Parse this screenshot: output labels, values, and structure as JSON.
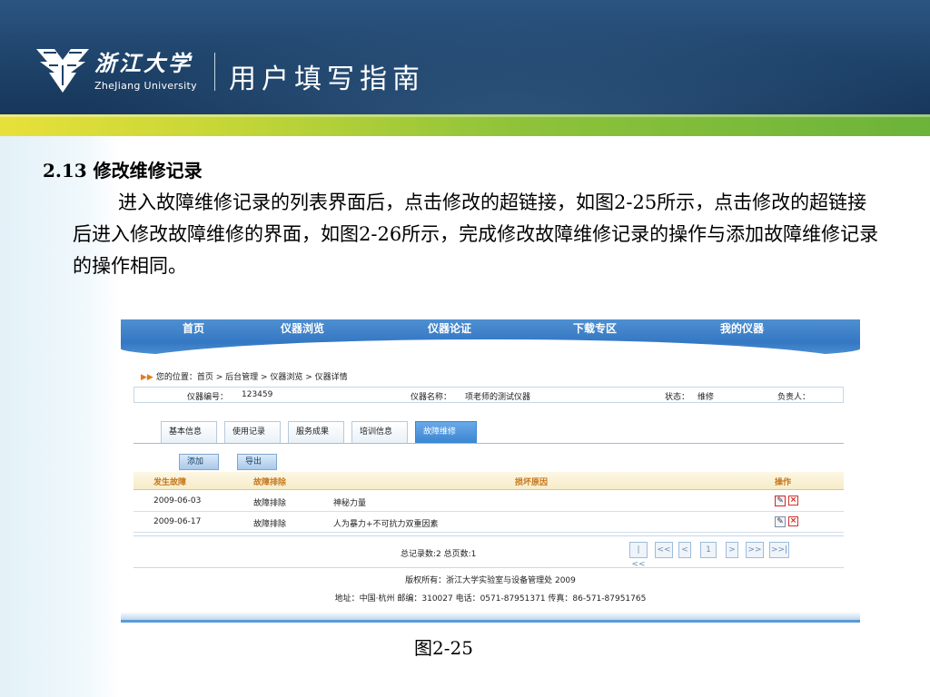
{
  "header": {
    "university_cn": "浙江大学",
    "university_en": "ZheJiang University",
    "title": "用户填写指南"
  },
  "content": {
    "section_title": "2.13 修改维修记录",
    "paragraph": "进入故障维修记录的列表界面后，点击修改的超链接，如图2-25所示，点击修改的超链接后进入修改故障维修的界面，如图2-26所示，完成修改故障维修记录的操作与添加故障维修记录的操作相同。",
    "caption": "图2-25"
  },
  "screenshot": {
    "nav": [
      "首页",
      "仪器浏览",
      "仪器论证",
      "下载专区",
      "我的仪器"
    ],
    "breadcrumb": "您的位置：首页 > 后台管理 > 仪器浏览 > 仪器详情",
    "info": {
      "id_label": "仪器编号：",
      "id_value": "123459",
      "name_label": "仪器名称：",
      "name_value": "项老师的测试仪器",
      "status_label": "状态：",
      "status_value": "维修",
      "owner_label": "负责人："
    },
    "tabs": [
      "基本信息",
      "使用记录",
      "服务成果",
      "培训信息",
      "故障维修"
    ],
    "buttons": {
      "add": "添加",
      "export": "导出"
    },
    "columns": [
      "发生故障",
      "故障排除",
      "损坏原因",
      "操作"
    ],
    "rows": [
      {
        "date": "2009-06-03",
        "status": "故障排除",
        "reason": "神秘力量"
      },
      {
        "date": "2009-06-17",
        "status": "故障排除",
        "reason": "人为暴力+不可抗力双重因素"
      }
    ],
    "totals": "总记录数:2  总页数:1",
    "pager": [
      "|<<",
      "<<",
      "<",
      "1",
      ">",
      ">>",
      ">>|"
    ],
    "copyright": "版权所有：浙江大学实验室与设备管理处  2009",
    "address": "地址：中国·杭州 邮编：310027 电话：0571-87951371 传真：86-571-87951765"
  },
  "colors": {
    "header_blue": "#1d4167",
    "band_green": "#8fc33a",
    "table_header_text": "#c7761b",
    "active_tab": "#3a86d2"
  },
  "icons": [
    "zju-logo-icon",
    "edit-icon",
    "delete-icon",
    "breadcrumb-arrow-icon"
  ]
}
